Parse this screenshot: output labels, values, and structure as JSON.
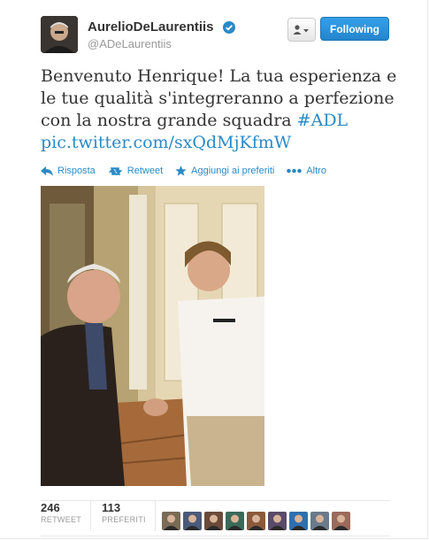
{
  "tweet": {
    "author_name": "AurelioDeLaurentiis",
    "handle": "@ADeLaurentiis",
    "follow_label": "Following",
    "text_parts": [
      "Benvenuto Henrique! La tua esperienza e le tue qualità s'integreranno a perfezione con la nostra grande squadra ",
      "#ADL",
      "pic.twitter.com/sxQdMjKfmW"
    ],
    "actions": {
      "reply": "Risposta",
      "retweet": "Retweet",
      "favorite": "Aggiungi ai preferiti",
      "more": "Altro"
    },
    "stats": [
      {
        "count": "246",
        "label": "RETWEET"
      },
      {
        "count": "113",
        "label": "PREFERITI"
      }
    ],
    "faces_count": 9
  },
  "icons": [
    "verified-badge-icon",
    "user-menu-icon",
    "reply-icon",
    "retweet-icon",
    "favorite-star-icon",
    "more-dots-icon"
  ],
  "colors": {
    "link": "#2a8ac6",
    "follow_button": "#2a8ac6",
    "text": "#333333",
    "muted": "#999999"
  }
}
